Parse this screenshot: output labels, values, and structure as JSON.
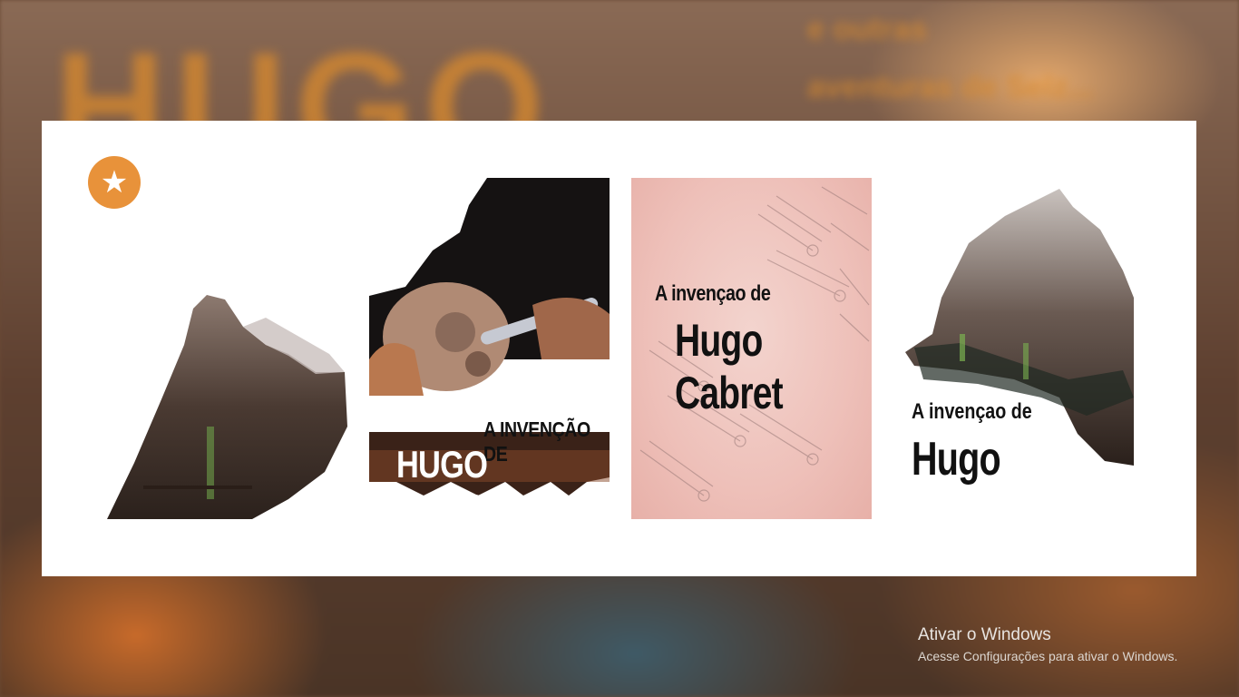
{
  "background": {
    "word": "HUGO",
    "lines": [
      "e outras",
      "aventuras de Selz...",
      ""
    ]
  },
  "favorite": {
    "icon": "star-icon",
    "color": "#e8923a"
  },
  "covers": [
    {
      "name": "cover-option-1",
      "alt": ""
    },
    {
      "name": "cover-option-2",
      "line1": "A INVENÇÃO DE",
      "line2": "HUGO CABRET"
    },
    {
      "name": "cover-option-3",
      "line1": "A invençao de",
      "line2": "Hugo Cabret"
    },
    {
      "name": "cover-option-4",
      "line1": "A invençao de",
      "line2": "Hugo Cabret"
    }
  ],
  "watermark": {
    "title": "Ativar o Windows",
    "subtitle": "Acesse Configurações para ativar o Windows."
  }
}
